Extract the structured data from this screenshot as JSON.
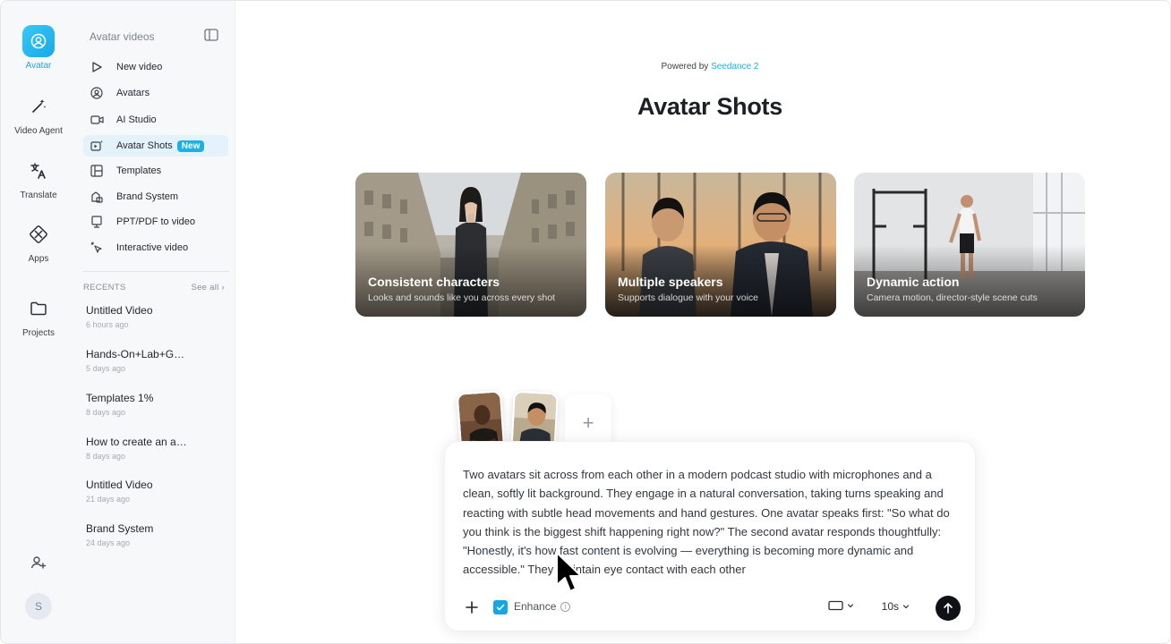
{
  "rail": {
    "items": [
      {
        "label": "Avatar",
        "icon": "avatar-icon",
        "active": true
      },
      {
        "label": "Video Agent",
        "icon": "magic-wand-icon"
      },
      {
        "label": "Translate",
        "icon": "translate-icon"
      },
      {
        "label": "Apps",
        "icon": "apps-icon"
      },
      {
        "label": "Projects",
        "icon": "folder-icon"
      }
    ],
    "user_initial": "S"
  },
  "sidebar": {
    "title": "Avatar videos",
    "nav": [
      {
        "label": "New video",
        "icon": "play-outline-icon"
      },
      {
        "label": "Avatars",
        "icon": "user-circle-icon"
      },
      {
        "label": "AI Studio",
        "icon": "camera-icon"
      },
      {
        "label": "Avatar Shots",
        "icon": "video-spark-icon",
        "badge": "New",
        "active": true
      },
      {
        "label": "Templates",
        "icon": "layout-icon"
      },
      {
        "label": "Brand System",
        "icon": "brand-icon"
      },
      {
        "label": "PPT/PDF to video",
        "icon": "slides-icon"
      },
      {
        "label": "Interactive video",
        "icon": "pointer-click-icon"
      }
    ],
    "recents_label": "RECENTS",
    "see_all": "See all ›",
    "recents": [
      {
        "title": "Untitled Video",
        "time": "6 hours ago"
      },
      {
        "title": "Hands-On+Lab+G…",
        "time": "5 days ago"
      },
      {
        "title": "Templates 1%",
        "time": "8 days ago"
      },
      {
        "title": "How to create an a…",
        "time": "8 days ago"
      },
      {
        "title": "Untitled Video",
        "time": "21 days ago"
      },
      {
        "title": "Brand System",
        "time": "24 days ago"
      }
    ]
  },
  "main": {
    "powered_prefix": "Powered by ",
    "powered_brand": "Seedance 2",
    "title": "Avatar Shots",
    "cards": [
      {
        "title": "Consistent characters",
        "subtitle": "Looks and sounds like you across every shot"
      },
      {
        "title": "Multiple speakers",
        "subtitle": "Supports dialogue with your voice"
      },
      {
        "title": "Dynamic action",
        "subtitle": "Camera motion, director-style scene cuts"
      }
    ]
  },
  "composer": {
    "add_ref_symbol": "+",
    "prompt": "Two avatars sit across from each other in a modern podcast studio with microphones and a clean, softly lit background. They engage in a natural conversation, taking turns speaking and reacting with subtle head movements and hand gestures. One avatar speaks first: \"So what do you think is the biggest shift happening right now?\" The second avatar responds thoughtfully: \"Honestly, it's how fast content is evolving — everything is becoming more dynamic and accessible.\" They maintain eye contact with each other",
    "enhance_label": "Enhance",
    "enhance_checked": true,
    "info_symbol": "i",
    "duration": "10s",
    "accent": "#14a7e6"
  }
}
